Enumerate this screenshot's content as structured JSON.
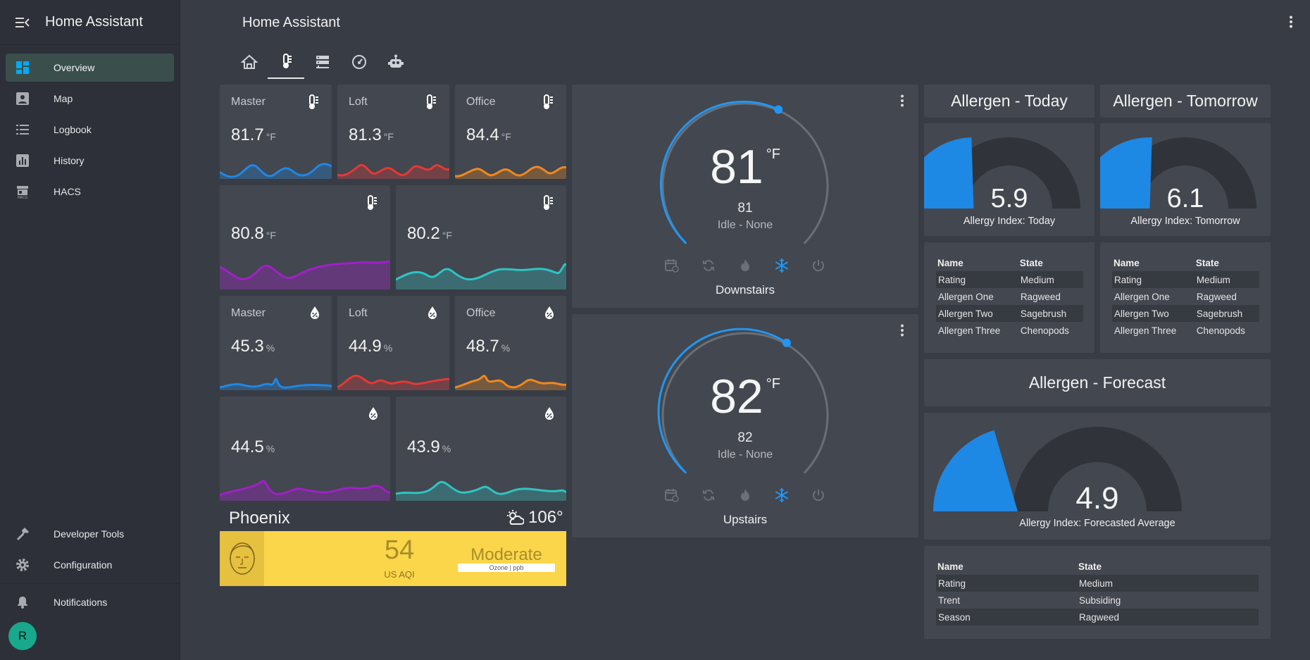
{
  "app": {
    "title": "Home Assistant",
    "header_title": "Home Assistant"
  },
  "sidebar": {
    "items": [
      {
        "label": "Overview",
        "icon": "dashboard-icon",
        "active": true
      },
      {
        "label": "Map",
        "icon": "map-icon"
      },
      {
        "label": "Logbook",
        "icon": "logbook-icon"
      },
      {
        "label": "History",
        "icon": "history-icon"
      },
      {
        "label": "HACS",
        "icon": "hacs-icon"
      }
    ],
    "bottom_items": [
      {
        "label": "Developer Tools",
        "icon": "hammer-icon"
      },
      {
        "label": "Configuration",
        "icon": "gear-icon"
      }
    ],
    "notifications": "Notifications",
    "user_initial": "R"
  },
  "tabs": [
    {
      "icon": "home-icon"
    },
    {
      "icon": "thermometer-icon",
      "active": true
    },
    {
      "icon": "server-icon"
    },
    {
      "icon": "gauge-icon"
    },
    {
      "icon": "robot-icon"
    }
  ],
  "temperature_sensors": [
    {
      "name": "Master",
      "value": "81.7",
      "unit": "°F",
      "color": "#1e88e5"
    },
    {
      "name": "Loft",
      "value": "81.3",
      "unit": "°F",
      "color": "#e53935"
    },
    {
      "name": "Office",
      "value": "84.4",
      "unit": "°F",
      "color": "#f0881f"
    },
    {
      "name": "",
      "value": "80.8",
      "unit": "°F",
      "color": "#a020c8"
    },
    {
      "name": "",
      "value": "80.2",
      "unit": "°F",
      "color": "#2ec4c4"
    }
  ],
  "humidity_sensors": [
    {
      "name": "Master",
      "value": "45.3",
      "unit": "%",
      "color": "#1e88e5"
    },
    {
      "name": "Loft",
      "value": "44.9",
      "unit": "%",
      "color": "#e53935"
    },
    {
      "name": "Office",
      "value": "48.7",
      "unit": "%",
      "color": "#f0881f"
    },
    {
      "name": "",
      "value": "44.5",
      "unit": "%",
      "color": "#a020c8"
    },
    {
      "name": "",
      "value": "43.9",
      "unit": "%",
      "color": "#2ec4c4"
    }
  ],
  "thermostats": [
    {
      "name": "Downstairs",
      "current": "81",
      "unit": "°F",
      "setpoint": "81",
      "state": "Idle - None",
      "active_mode": "cool"
    },
    {
      "name": "Upstairs",
      "current": "82",
      "unit": "°F",
      "setpoint": "82",
      "state": "Idle - None",
      "active_mode": "cool"
    }
  ],
  "weather": {
    "city": "Phoenix",
    "temperature": "106°",
    "icon": "partly-cloudy-icon"
  },
  "aqi": {
    "value": "54",
    "label": "US AQI",
    "level": "Moderate",
    "pollutant": "Ozone | ppb",
    "color": "#fcd64a"
  },
  "allergen": {
    "today": {
      "heading": "Allergen - Today",
      "value": "5.9",
      "fraction": 0.49,
      "label": "Allergy Index: Today",
      "table": {
        "headers": [
          "Name",
          "State"
        ],
        "rows": [
          [
            "Rating",
            "Medium"
          ],
          [
            "Allergen One",
            "Ragweed"
          ],
          [
            "Allergen Two",
            "Sagebrush"
          ],
          [
            "Allergen Three",
            "Chenopods"
          ]
        ]
      }
    },
    "tomorrow": {
      "heading": "Allergen - Tomorrow",
      "value": "6.1",
      "fraction": 0.51,
      "label": "Allergy Index: Tomorrow",
      "table": {
        "headers": [
          "Name",
          "State"
        ],
        "rows": [
          [
            "Rating",
            "Medium"
          ],
          [
            "Allergen One",
            "Ragweed"
          ],
          [
            "Allergen Two",
            "Sagebrush"
          ],
          [
            "Allergen Three",
            "Chenopods"
          ]
        ]
      }
    },
    "forecast": {
      "heading": "Allergen - Forecast",
      "value": "4.9",
      "fraction": 0.41,
      "label": "Allergy Index: Forecasted Average",
      "table": {
        "headers": [
          "Name",
          "State"
        ],
        "rows": [
          [
            "Rating",
            "Medium"
          ],
          [
            "Trent",
            "Subsiding"
          ],
          [
            "Season",
            "Ragweed"
          ]
        ]
      }
    },
    "gauge_color": "#1e88e5"
  }
}
